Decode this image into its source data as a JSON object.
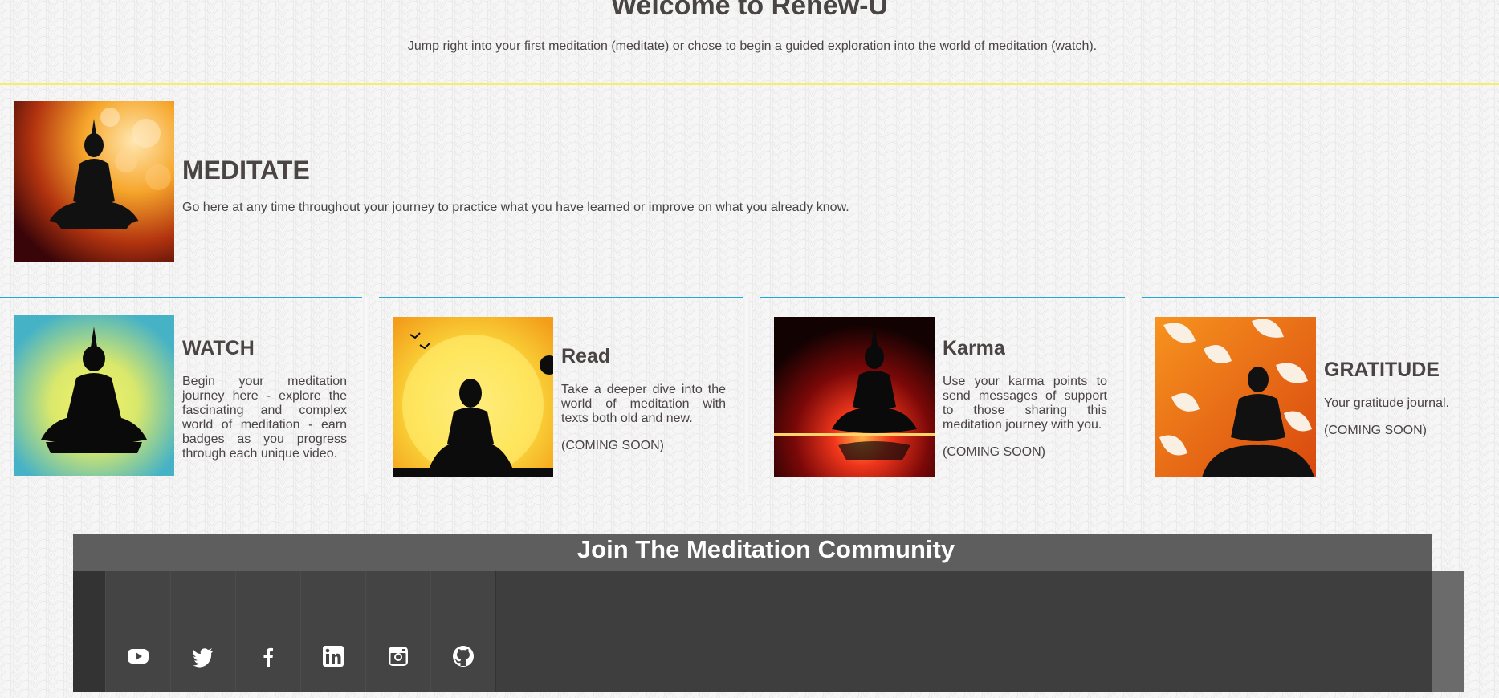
{
  "header": {
    "title": "Welcome to Renew-U",
    "subtitle": "Jump right into your first meditation (meditate) or chose to begin a guided exploration into the world of meditation (watch)."
  },
  "meditate": {
    "heading": "MEDITATE",
    "description": "Go here at any time throughout your journey to practice what you have learned or improve on what you already know."
  },
  "cards": [
    {
      "heading": "WATCH",
      "description": "Begin your meditation journey here - explore the fascinating and complex world of meditation - earn badges as you progress through each unique video.",
      "status": ""
    },
    {
      "heading": "Read",
      "description": "Take a deeper dive into the world of meditation with texts both old and new.",
      "status": "(COMING SOON)"
    },
    {
      "heading": "Karma",
      "description": "Use your karma points to send messages of support to those sharing this meditation journey with you.",
      "status": "(COMING SOON)"
    },
    {
      "heading": "GRATITUDE",
      "description": "Your gratitude journal.",
      "status": "(COMING SOON)"
    }
  ],
  "footer": {
    "heading": "Join The Meditation Community",
    "social_icons": [
      "youtube-icon",
      "twitter-icon",
      "facebook-icon",
      "linkedin-icon",
      "instagram-icon",
      "github-icon"
    ]
  },
  "colors": {
    "accent_blue": "#22a8d6",
    "accent_yellow": "#f3ef6b",
    "footer_dark": "#3e3e3e",
    "footer_header": "#5e5e5e"
  }
}
